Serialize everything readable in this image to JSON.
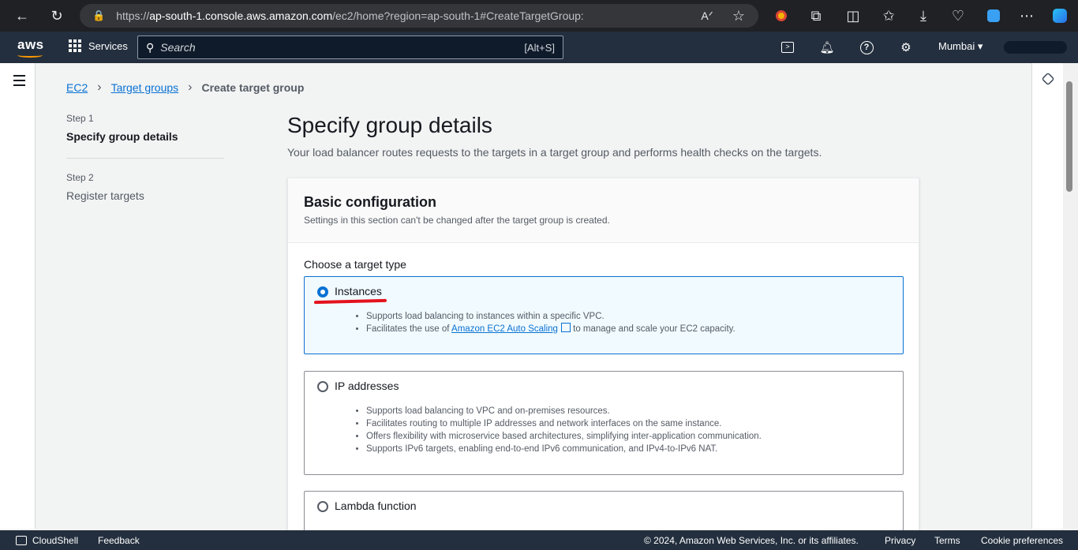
{
  "browser": {
    "url_prefix": "https://",
    "url_host": "ap-south-1.console.aws.amazon.com",
    "url_path": "/ec2/home?region=ap-south-1#CreateTargetGroup:"
  },
  "aws_nav": {
    "logo": "aws",
    "services_label": "Services",
    "search_placeholder": "Search",
    "search_shortcut": "[Alt+S]",
    "region": "Mumbai ▾"
  },
  "breadcrumb": {
    "items": [
      "EC2",
      "Target groups"
    ],
    "current": "Create target group"
  },
  "steps": [
    {
      "label": "Step 1",
      "title": "Specify group details"
    },
    {
      "label": "Step 2",
      "title": "Register targets"
    }
  ],
  "page": {
    "title": "Specify group details",
    "description": "Your load balancer routes requests to the targets in a target group and performs health checks on the targets."
  },
  "basic_config": {
    "title": "Basic configuration",
    "subtitle": "Settings in this section can't be changed after the target group is created.",
    "choose_label": "Choose a target type",
    "options": [
      {
        "label": "Instances",
        "selected": true,
        "bullets": [
          "Supports load balancing to instances within a specific VPC."
        ],
        "bullet2_prefix": "Facilitates the use of ",
        "bullet2_link": "Amazon EC2 Auto Scaling",
        "bullet2_suffix": " to manage and scale your EC2 capacity."
      },
      {
        "label": "IP addresses",
        "selected": false,
        "bullets": [
          "Supports load balancing to VPC and on-premises resources.",
          "Facilitates routing to multiple IP addresses and network interfaces on the same instance.",
          "Offers flexibility with microservice based architectures, simplifying inter-application communication.",
          "Supports IPv6 targets, enabling end-to-end IPv6 communication, and IPv4-to-IPv6 NAT."
        ]
      },
      {
        "label": "Lambda function",
        "selected": false
      }
    ]
  },
  "footer": {
    "cloudshell": "CloudShell",
    "feedback": "Feedback",
    "copyright": "© 2024, Amazon Web Services, Inc. or its affiliates.",
    "privacy": "Privacy",
    "terms": "Terms",
    "cookies": "Cookie preferences"
  },
  "colors": {
    "aws_nav_bg": "#232f3e",
    "link_blue": "#0972d3",
    "selected_tile_bg": "#f1faff",
    "annotation_red": "#e3121d"
  }
}
